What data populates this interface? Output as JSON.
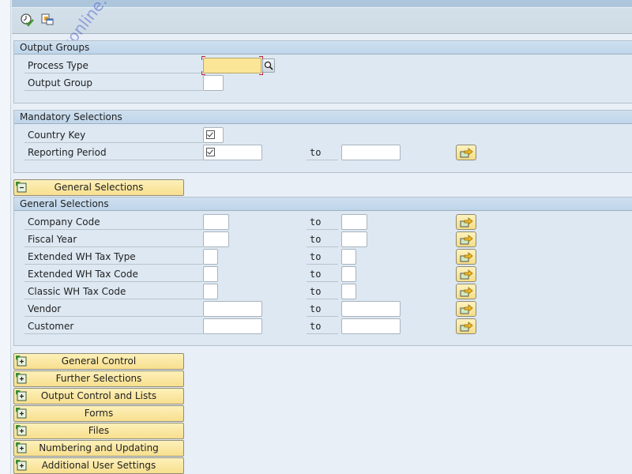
{
  "toolbar": {
    "icons": [
      "execute-icon",
      "get-variant-icon"
    ]
  },
  "watermark": "sapbrainsonline.com",
  "output_groups": {
    "title": "Output Groups",
    "fields": [
      {
        "label": "Process Type",
        "value": "",
        "required": true
      },
      {
        "label": "Output Group",
        "value": ""
      }
    ]
  },
  "mandatory_selections": {
    "title": "Mandatory Selections",
    "fields": [
      {
        "label": "Country Key",
        "checked": true
      },
      {
        "label": "Reporting Period",
        "checked": true,
        "to_label": "to",
        "to_value": ""
      }
    ]
  },
  "general_selections_button": {
    "label": "General Selections",
    "state": "expanded"
  },
  "general_selections": {
    "title": "General Selections",
    "fields": [
      {
        "label": "Company Code",
        "from": "",
        "to_label": "to",
        "to": ""
      },
      {
        "label": "Fiscal Year",
        "from": "",
        "to_label": "to",
        "to": ""
      },
      {
        "label": "Extended WH Tax Type",
        "from": "",
        "to_label": "to",
        "to": ""
      },
      {
        "label": "Extended WH Tax Code",
        "from": "",
        "to_label": "to",
        "to": ""
      },
      {
        "label": "Classic WH Tax Code",
        "from": "",
        "to_label": "to",
        "to": ""
      },
      {
        "label": "Vendor",
        "from": "",
        "to_label": "to",
        "to": ""
      },
      {
        "label": "Customer",
        "from": "",
        "to_label": "to",
        "to": ""
      }
    ]
  },
  "collapsed_blocks": [
    {
      "label": "General Control",
      "state": "collapsed"
    },
    {
      "label": "Further Selections",
      "state": "collapsed"
    },
    {
      "label": "Output Control and Lists",
      "state": "collapsed"
    },
    {
      "label": "Forms",
      "state": "collapsed"
    },
    {
      "label": "Files",
      "state": "collapsed"
    },
    {
      "label": "Numbering and Updating",
      "state": "collapsed"
    },
    {
      "label": "Additional User Settings",
      "state": "collapsed"
    }
  ],
  "colors": {
    "required_field": "#fbe596",
    "block_button": "#f7df8e",
    "group_bg": "#dde8f2",
    "header_bg": "#bed5ea"
  }
}
